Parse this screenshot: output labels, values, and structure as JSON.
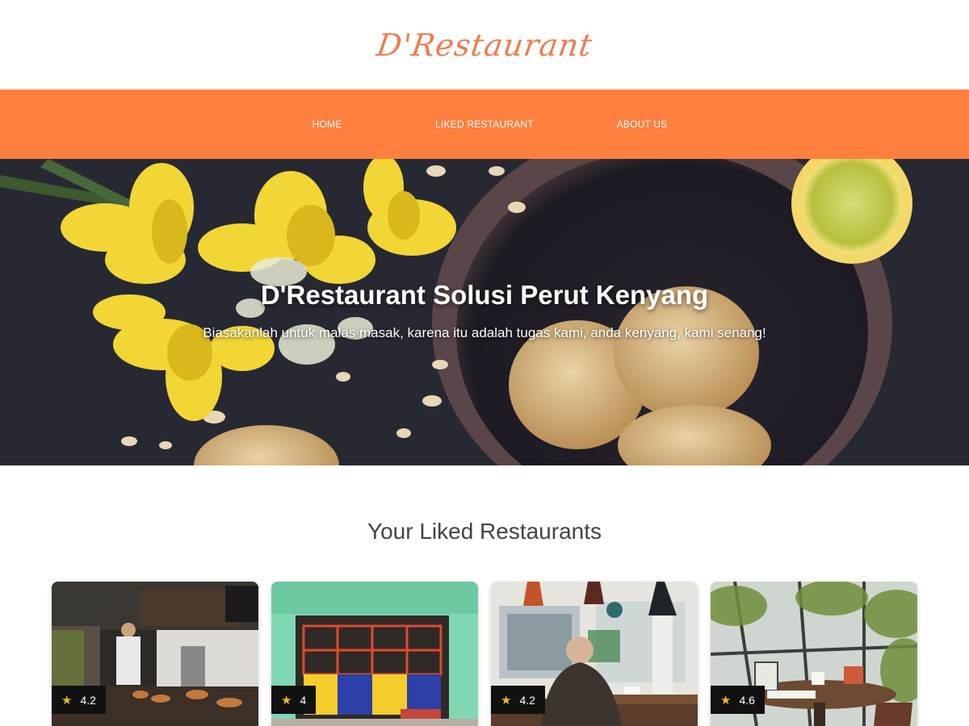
{
  "brand": {
    "logo_text": "D'Restaurant"
  },
  "nav": {
    "items": [
      {
        "label": "HOME"
      },
      {
        "label": "LIKED RESTAURANT"
      },
      {
        "label": "ABOUT US"
      }
    ],
    "color": "#ff7f3e"
  },
  "hero": {
    "title": "D'Restaurant Solusi Perut Kenyang",
    "subtitle": "Biasakanlah untuk malas masak, karena itu adalah tugas kami, anda kenyang, kami senang!"
  },
  "liked": {
    "heading": "Your Liked Restaurants",
    "cards": [
      {
        "rating": "4.2",
        "star_icon": "star-icon"
      },
      {
        "rating": "4",
        "star_icon": "star-icon"
      },
      {
        "rating": "4.2",
        "star_icon": "star-icon"
      },
      {
        "rating": "4.6",
        "star_icon": "star-icon"
      }
    ]
  },
  "colors": {
    "accent": "#ff7f3e",
    "logo": "#ef7c4c",
    "star": "#f5b91e"
  }
}
